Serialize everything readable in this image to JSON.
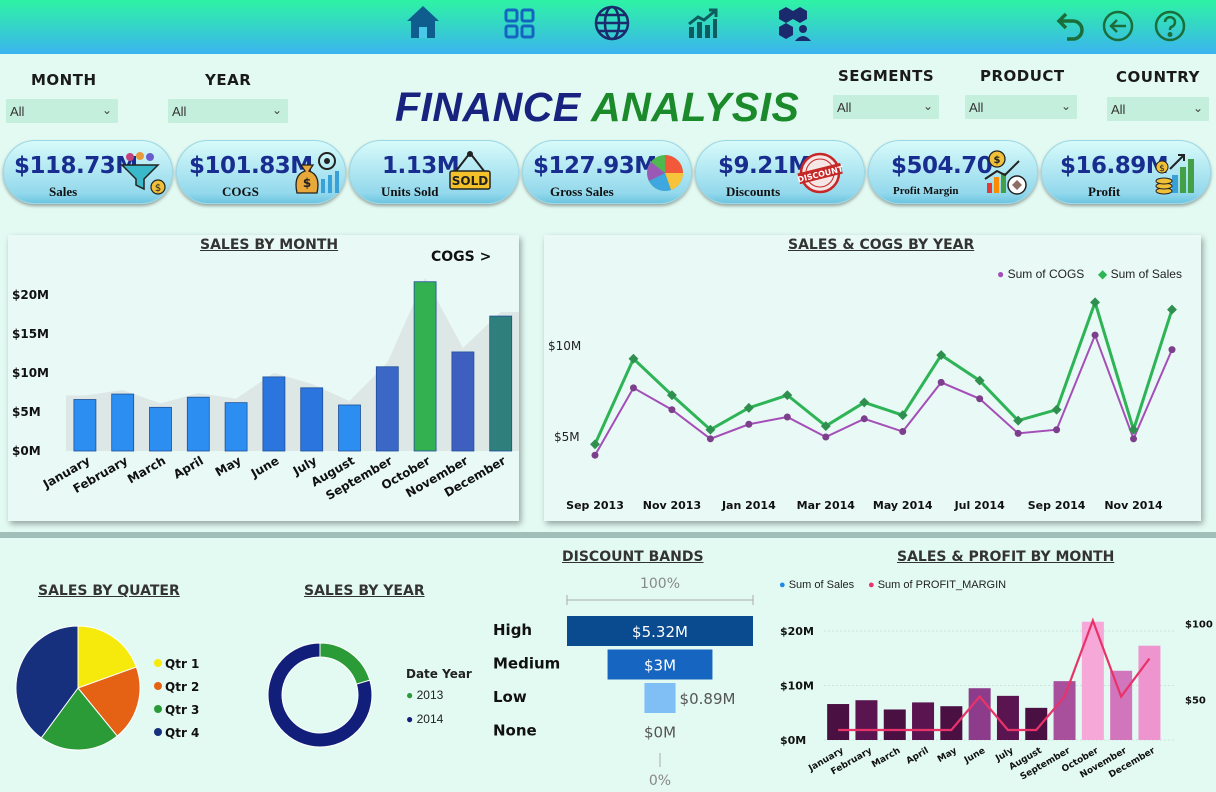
{
  "filters": {
    "month": {
      "label": "MONTH",
      "value": "All"
    },
    "year": {
      "label": "YEAR",
      "value": "All"
    },
    "segments": {
      "label": "SEGMENTS",
      "value": "All"
    },
    "product": {
      "label": "PRODUCT",
      "value": "All"
    },
    "country": {
      "label": "COUNTRY",
      "value": "All"
    }
  },
  "title": {
    "part1": "FINANCE",
    "part2": "ANALYSIS"
  },
  "nav_icons": [
    "home-icon",
    "grid-icon",
    "globe-icon",
    "chart-icon",
    "users-icon",
    "undo-icon",
    "back-icon",
    "help-icon"
  ],
  "kpis": [
    {
      "value": "$118.73M",
      "label": "Sales",
      "icon": "sales-funnel-icon"
    },
    {
      "value": "$101.83M",
      "label": "COGS",
      "icon": "money-bag-icon"
    },
    {
      "value": "1.13M",
      "label": "Units Sold",
      "icon": "sold-sign-icon"
    },
    {
      "value": "$127.93M",
      "label": "Gross Sales",
      "icon": "pie-icon"
    },
    {
      "value": "$9.21M",
      "label": "Discounts",
      "icon": "discount-stamp-icon"
    },
    {
      "value": "$504.70",
      "label": "Profit Margin",
      "icon": "profit-chart-icon"
    },
    {
      "value": "$16.89M",
      "label": "Profit",
      "icon": "coins-growth-icon"
    }
  ],
  "colors": {
    "title_blue": "#17237e",
    "title_green": "#1a8a2a",
    "kpi_text": "#182d8f"
  },
  "sales_by_month": {
    "title": "SALES BY MONTH",
    "cogs_link": "COGS >",
    "chart_data": {
      "type": "bar",
      "categories": [
        "January",
        "February",
        "March",
        "April",
        "May",
        "June",
        "July",
        "August",
        "September",
        "October",
        "November",
        "December"
      ],
      "values": [
        6.6,
        7.3,
        5.6,
        6.9,
        6.2,
        9.5,
        8.1,
        5.9,
        10.8,
        21.7,
        12.7,
        17.3
      ],
      "ylim": [
        0,
        22
      ],
      "yticks": [
        "$0M",
        "$5M",
        "$10M",
        "$15M",
        "$20M"
      ],
      "highlight": "October"
    }
  },
  "sales_cogs_year": {
    "title": "SALES & COGS BY YEAR",
    "legend": [
      "Sum of  COGS",
      "Sum of   Sales"
    ],
    "chart_data": {
      "type": "line",
      "x": [
        "Sep 2013",
        "Oct 2013",
        "Nov 2013",
        "Dec 2013",
        "Jan 2014",
        "Feb 2014",
        "Mar 2014",
        "Apr 2014",
        "May 2014",
        "Jun 2014",
        "Jul 2014",
        "Aug 2014",
        "Sep 2014",
        "Oct 2014",
        "Nov 2014",
        "Dec 2014"
      ],
      "xticks": [
        "Sep 2013",
        "Nov 2013",
        "Jan 2014",
        "Mar 2014",
        "May 2014",
        "Jul 2014",
        "Sep 2014",
        "Nov 2014"
      ],
      "yticks": [
        "$5M",
        "$10M"
      ],
      "series": [
        {
          "name": "Sum of  COGS",
          "color": "#a44fb8",
          "values": [
            4.0,
            7.7,
            6.5,
            4.9,
            5.7,
            6.1,
            5.0,
            6.0,
            5.3,
            8.0,
            7.1,
            5.2,
            5.4,
            10.6,
            4.9,
            9.8
          ]
        },
        {
          "name": "Sum of   Sales",
          "color": "#2eb356",
          "values": [
            4.6,
            9.3,
            7.3,
            5.4,
            6.6,
            7.3,
            5.6,
            6.9,
            6.2,
            9.5,
            8.1,
            5.9,
            6.5,
            12.4,
            5.4,
            12.0
          ]
        }
      ]
    }
  },
  "sales_by_quarter": {
    "title": "SALES BY QUATER",
    "chart_data": {
      "type": "pie",
      "labels": [
        "Qtr 1",
        "Qtr 2",
        "Qtr 3",
        "Qtr 4"
      ],
      "values": [
        19.5,
        19.6,
        21.0,
        39.9
      ],
      "colors": [
        "#f5ea0c",
        "#e56114",
        "#2b9b38",
        "#17307e"
      ]
    }
  },
  "sales_by_year": {
    "title": "SALES BY YEAR",
    "legend_title": "Date Year",
    "chart_data": {
      "type": "pie",
      "labels": [
        "2013",
        "2014"
      ],
      "values": [
        20.4,
        79.6
      ],
      "colors": [
        "#2b9b38",
        "#121f7a"
      ]
    }
  },
  "discount_bands": {
    "title": "DISCOUNT BANDS",
    "top_label": "100%",
    "bottom_label": "0%",
    "chart_data": {
      "type": "bar",
      "categories": [
        "High",
        "Medium",
        "Low",
        "None"
      ],
      "values": [
        5.32,
        3.0,
        0.89,
        0.0
      ],
      "labels": [
        "$5.32M",
        "$3M",
        "$0.89M",
        "$0M"
      ],
      "colors": [
        "#0a4a8f",
        "#1665c0",
        "#7fbff5",
        "#7fbff5"
      ]
    }
  },
  "sales_profit_month": {
    "title": "SALES & PROFIT BY MONTH",
    "legend": [
      "Sum of   Sales",
      "Sum of PROFIT_MARGIN"
    ],
    "chart_data": {
      "type": "bar",
      "categories": [
        "January",
        "February",
        "March",
        "April",
        "May",
        "June",
        "July",
        "August",
        "September",
        "October",
        "November",
        "December"
      ],
      "series": [
        {
          "name": "Sum of   Sales",
          "type": "bar",
          "values": [
            6.6,
            7.3,
            5.6,
            6.9,
            6.2,
            9.5,
            8.1,
            5.9,
            10.8,
            21.7,
            12.7,
            17.3
          ]
        },
        {
          "name": "Sum of PROFIT_MARGIN",
          "type": "line",
          "color": "#e8336a",
          "values": [
            30,
            30,
            30,
            30,
            30,
            52,
            30,
            30,
            52,
            102,
            52,
            77
          ]
        }
      ],
      "yticks_left": [
        "$0M",
        "$10M",
        "$20M"
      ],
      "yticks_right": [
        "$50",
        "$100"
      ],
      "bar_colors": [
        "#4b1042",
        "#5a1450",
        "#4b1042",
        "#5a1450",
        "#4b1042",
        "#8c3c8a",
        "#5a1450",
        "#4b1042",
        "#a8509b",
        "#f6a8d8",
        "#d176bc",
        "#ee95cf"
      ]
    }
  }
}
